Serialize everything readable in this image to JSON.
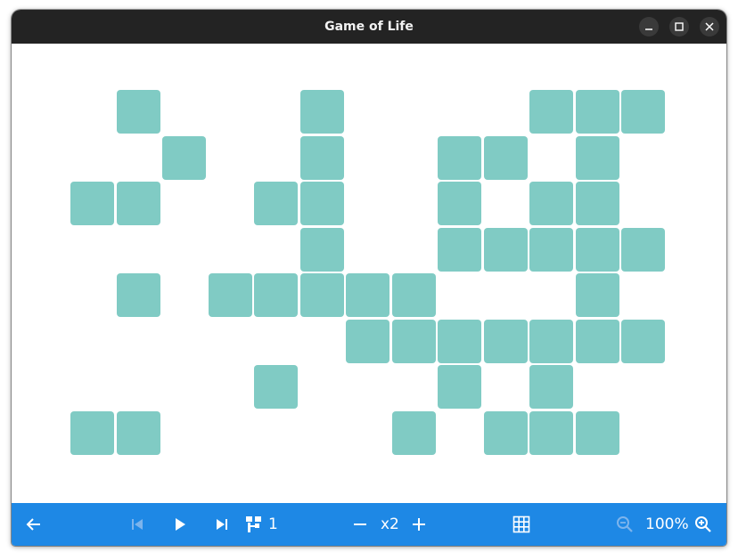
{
  "window": {
    "title": "Game of Life"
  },
  "window_controls": [
    "minimize",
    "maximize",
    "close"
  ],
  "board": {
    "cell_color": "#80cbc4",
    "background": "#ffffff",
    "columns": 13,
    "rows": 8,
    "live_cells": [
      [
        0,
        1
      ],
      [
        0,
        5
      ],
      [
        0,
        10
      ],
      [
        0,
        11
      ],
      [
        0,
        12
      ],
      [
        1,
        2
      ],
      [
        1,
        5
      ],
      [
        1,
        8
      ],
      [
        1,
        9
      ],
      [
        1,
        11
      ],
      [
        2,
        0
      ],
      [
        2,
        1
      ],
      [
        2,
        4
      ],
      [
        2,
        5
      ],
      [
        2,
        8
      ],
      [
        2,
        10
      ],
      [
        2,
        11
      ],
      [
        3,
        5
      ],
      [
        3,
        8
      ],
      [
        3,
        9
      ],
      [
        3,
        10
      ],
      [
        3,
        11
      ],
      [
        3,
        12
      ],
      [
        4,
        1
      ],
      [
        4,
        3
      ],
      [
        4,
        4
      ],
      [
        4,
        5
      ],
      [
        4,
        6
      ],
      [
        4,
        7
      ],
      [
        4,
        11
      ],
      [
        5,
        6
      ],
      [
        5,
        7
      ],
      [
        5,
        8
      ],
      [
        5,
        9
      ],
      [
        5,
        10
      ],
      [
        5,
        11
      ],
      [
        5,
        12
      ],
      [
        6,
        4
      ],
      [
        6,
        8
      ],
      [
        6,
        10
      ],
      [
        7,
        0
      ],
      [
        7,
        1
      ],
      [
        7,
        7
      ],
      [
        7,
        9
      ],
      [
        7,
        10
      ],
      [
        7,
        11
      ]
    ]
  },
  "toolbar": {
    "background": "#1e88e5",
    "generation": "1",
    "speed": "x2",
    "zoom": "100%",
    "first_disabled": true,
    "zoom_out_disabled": true
  }
}
